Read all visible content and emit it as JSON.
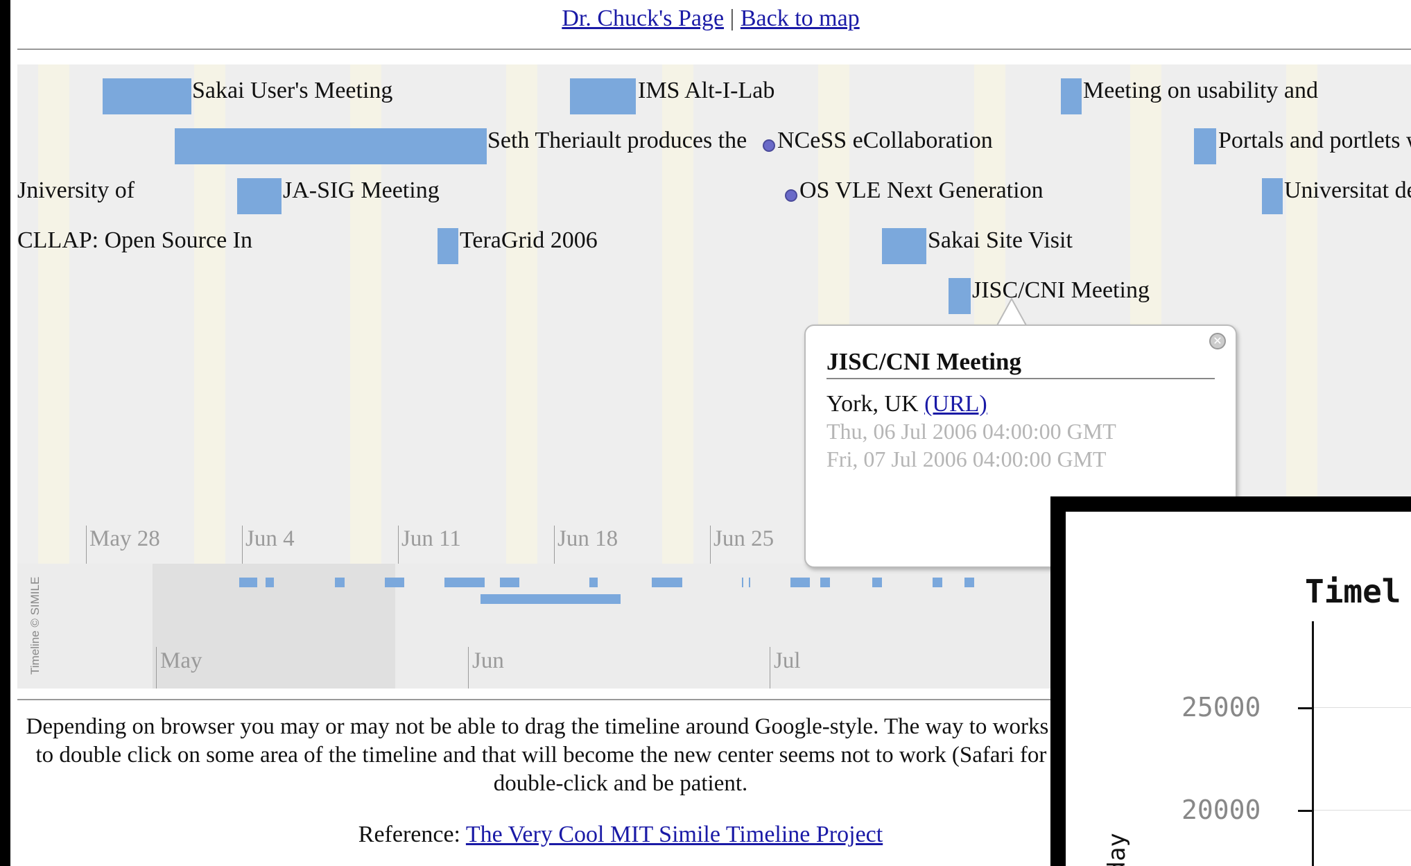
{
  "nav": {
    "home_link": "Dr. Chuck's Page",
    "separator": "|",
    "map_link": "Back to map"
  },
  "events": [
    {
      "label": "Sakai User's Meeting"
    },
    {
      "label": "IMS Alt-I-Lab"
    },
    {
      "label": "Meeting on usability and"
    },
    {
      "label": "Seth Theriault produces the"
    },
    {
      "label": "NCeSS eCollaboration"
    },
    {
      "label": "Portals and portlets w"
    },
    {
      "label": "Jniversity of"
    },
    {
      "label": "JA-SIG Meeting"
    },
    {
      "label": "OS VLE Next Generation"
    },
    {
      "label": "Universitat de"
    },
    {
      "label": "CLLAP: Open Source In"
    },
    {
      "label": "TeraGrid 2006"
    },
    {
      "label": "Sakai Site Visit"
    },
    {
      "label": "JISC/CNI Meeting"
    }
  ],
  "upper_ticks": [
    "May 28",
    "Jun 4",
    "Jun 11",
    "Jun 18",
    "Jun 25"
  ],
  "lower_ticks": [
    "May",
    "Jun",
    "Jul"
  ],
  "credit": "Timeline © SIMILE",
  "popup": {
    "title": "JISC/CNI Meeting",
    "location": "York, UK",
    "url_label": "(URL)",
    "start": "Thu, 06 Jul 2006 04:00:00 GMT",
    "end": "Fri, 07 Jul 2006 04:00:00 GMT"
  },
  "description": "Depending on browser you may or may not be able to drag the timeline around Google-style. The way to works on all browsers is to double click on some area of the timeline and that will become the new center seems not to work (Safari for example) simply double-click and be patient.",
  "reference": {
    "prefix": "Reference:",
    "link": "The Very Cool MIT Simile Timeline Project"
  },
  "overlay_chart": {
    "title_fragment": "Timel",
    "y_ticks": [
      "25000",
      "20000"
    ],
    "y_label_fragment": "/day"
  },
  "colors": {
    "event_bar": "#7ba8dc",
    "event_dot": "#6a6ac8",
    "link": "#1a1aa6"
  }
}
